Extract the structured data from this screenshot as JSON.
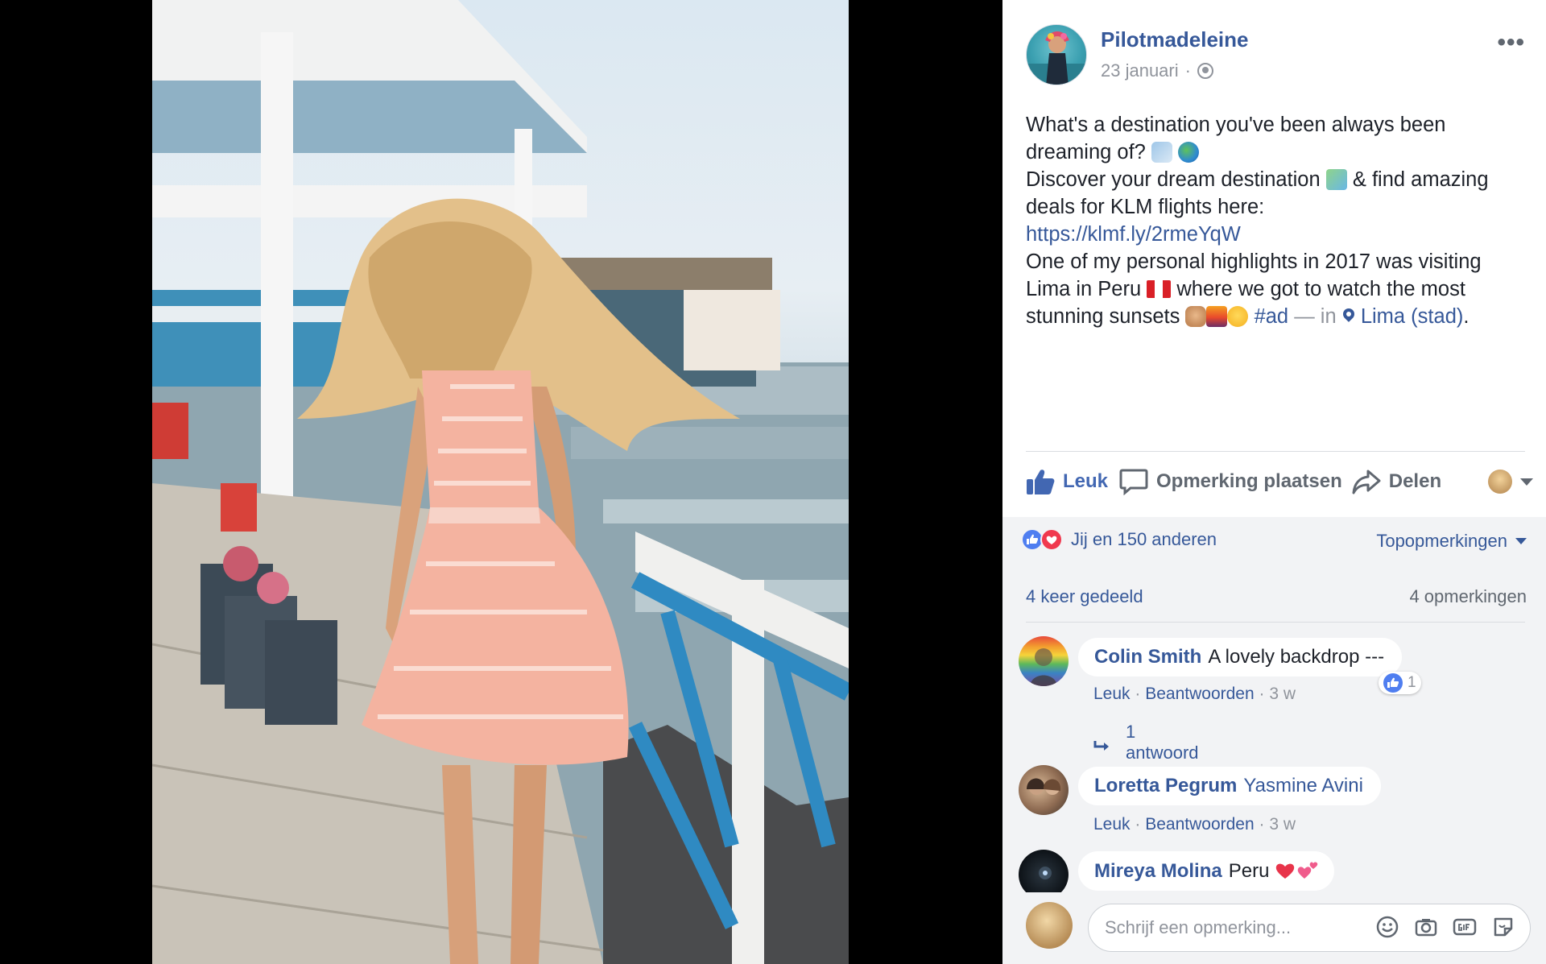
{
  "post": {
    "author": "Pilotmadeleine",
    "date": "23 januari",
    "separator": "·",
    "more_label": "•••",
    "text": {
      "line1": "What's a destination you've been always been dreaming of?",
      "line2a": "Discover your dream destination",
      "line2b": "& find amazing deals for KLM flights here:",
      "link": "https://klmf.ly/2rmeYqW",
      "line3a": "One of my personal highlights in 2017 was visiting Lima in Peru",
      "line3b": "where we got to watch the most stunning sunsets",
      "hashtag": "#ad",
      "in_sep": "— in",
      "location": "Lima (stad)",
      "period": "."
    }
  },
  "actions": {
    "like_label": "Leuk",
    "comment_label": "Opmerking plaatsen",
    "share_label": "Delen"
  },
  "stats": {
    "reactions_text": "Jij en 150 anderen",
    "sort_label": "Topopmerkingen",
    "shares_text": "4 keer gedeeld",
    "comments_text": "4 opmerkingen"
  },
  "comments": [
    {
      "name": "Colin Smith",
      "text": "A lovely backdrop ---",
      "like_label": "Leuk",
      "reply_label": "Beantwoorden",
      "time": "3 w",
      "like_count": "1",
      "replies_label": "1 antwoord"
    },
    {
      "name": "Loretta Pegrum",
      "tag": "Yasmine Avini",
      "like_label": "Leuk",
      "reply_label": "Beantwoorden",
      "time": "3 w"
    },
    {
      "name": "Mireya Molina",
      "text": "Peru"
    }
  ],
  "composer": {
    "placeholder": "Schrijf een opmerking..."
  },
  "icons": {
    "globe": "globe-icon",
    "like": "thumbs-up-icon",
    "comment": "speech-bubble-icon",
    "share": "share-arrow-icon",
    "emoji": "smiley-icon",
    "camera": "camera-icon",
    "gif": "gif-icon",
    "sticker": "sticker-icon"
  },
  "colors": {
    "link": "#365899",
    "like_blue": "#4267b2",
    "panel_gray": "#f2f3f5",
    "text": "#1d2129",
    "muted": "#90949c"
  }
}
